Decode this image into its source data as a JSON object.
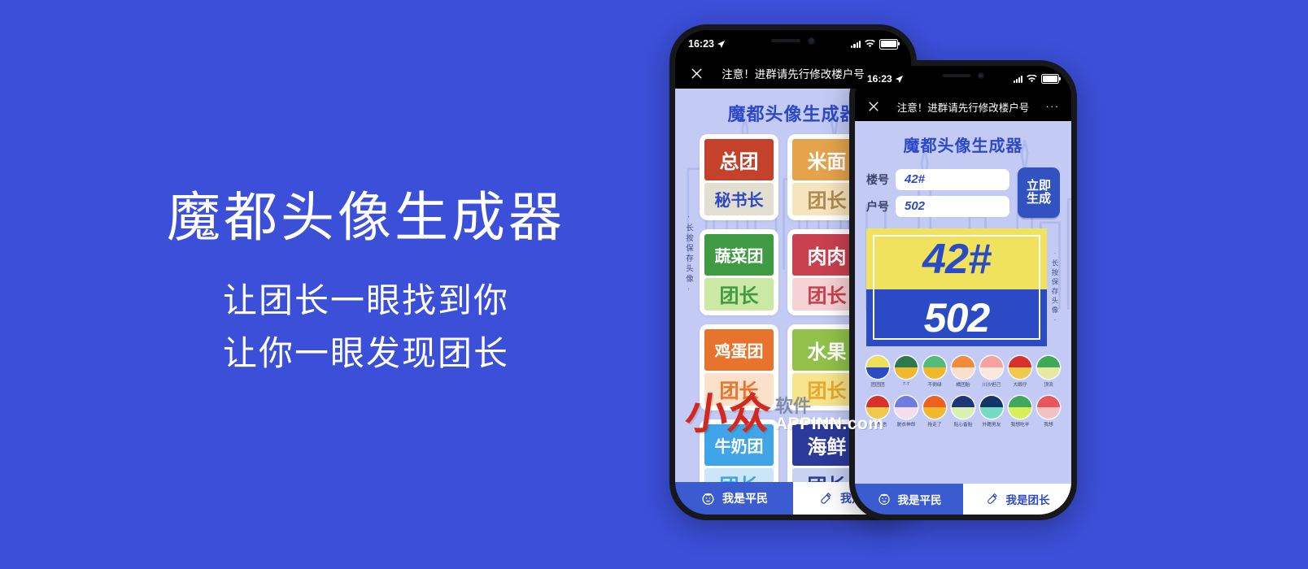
{
  "background_color": "#3B4FD8",
  "promo": {
    "title": "魔都头像生成器",
    "subtitle_line1": "让团长一眼找到你",
    "subtitle_line2": "让你一眼发现团长"
  },
  "watermark": {
    "logo": "小众",
    "cn": "软件",
    "en": "APPINN.com"
  },
  "back_phone": {
    "status": {
      "time": "16:23",
      "location_icon": "location-arrow-icon",
      "signal_icon": "cellular-bars-icon",
      "wifi_icon": "wifi-icon",
      "battery_icon": "battery-icon"
    },
    "nav": {
      "close_icon": "close-icon",
      "title": "注意！进群请先行修改楼户号",
      "more_icon": "more-dots-icon"
    },
    "app_title": "魔都头像生成器",
    "save_tip": "·长按保存头像·",
    "cards": [
      {
        "top": "总团",
        "bottom": "秘书长",
        "top_color": "#C4422C",
        "bottom_bg": "#E2DED0",
        "bottom_color": "#2E49C8"
      },
      {
        "top": "米面",
        "bottom": "团长",
        "top_color": "#E5A34C",
        "bottom_bg": "#F6E4BE",
        "bottom_color": "#B08A4E"
      },
      {
        "top": "蔬菜团",
        "bottom": "团长",
        "top_color": "#3E9B43",
        "bottom_bg": "#CBE8A4",
        "bottom_color": "#3E9B43"
      },
      {
        "top": "肉肉",
        "bottom": "团长",
        "top_color": "#C9404F",
        "bottom_bg": "#F6D2D4",
        "bottom_color": "#C9404F"
      },
      {
        "top": "鸡蛋团",
        "bottom": "团长",
        "top_color": "#E8732C",
        "bottom_bg": "#FBE0CA",
        "bottom_color": "#E8732C"
      },
      {
        "top": "水果",
        "bottom": "团长",
        "top_color": "#91C14A",
        "bottom_bg": "#F6E58C",
        "bottom_color": "#E8A72C"
      },
      {
        "top": "牛奶团",
        "bottom": "团长",
        "top_color": "#3FA4E8",
        "bottom_bg": "#CBE6F8",
        "bottom_color": "#3FA4E8"
      },
      {
        "top": "海鲜",
        "bottom": "团长",
        "top_color": "#2B3A9B",
        "bottom_bg": "#C7D2F0",
        "bottom_color": "#2B3A9B"
      }
    ],
    "tabs": [
      {
        "label": "我是平民",
        "icon": "baby-face-icon",
        "active": true
      },
      {
        "label": "我是团长",
        "icon": "baby-bottle-icon",
        "active": false
      }
    ]
  },
  "front_phone": {
    "status": {
      "time": "16:23",
      "location_icon": "location-arrow-icon",
      "signal_icon": "cellular-bars-icon",
      "wifi_icon": "wifi-icon",
      "battery_icon": "battery-icon"
    },
    "nav": {
      "close_icon": "close-icon",
      "title": "注意！进群请先行修改楼户号",
      "more_icon": "more-dots-icon"
    },
    "app_title": "魔都头像生成器",
    "form": {
      "building_label": "楼号",
      "building_value": "42#",
      "unit_label": "户号",
      "unit_value": "502",
      "generate_label_line1": "立即",
      "generate_label_line2": "生成"
    },
    "preview": {
      "top_text": "42#",
      "bottom_text": "502",
      "top_bg": "#F0E25C",
      "bottom_bg": "#2B4BC6",
      "top_fg": "#2B4BC6",
      "bottom_fg": "#FFFFFF"
    },
    "save_tip": "·长按保存头像·",
    "swatch_rows": [
      [
        {
          "label": "团团团",
          "top": "#EDE05A",
          "bottom": "#2B4BC6"
        },
        {
          "label": "7-7",
          "top": "#2C7A4B",
          "bottom": "#F0B92C"
        },
        {
          "label": "不倒绿",
          "top": "#54BC7B",
          "bottom": "#F0B92C"
        },
        {
          "label": "橘团胎",
          "top": "#F08A3C",
          "bottom": "#FAE0CC"
        },
        {
          "label": "川沙妲己",
          "top": "#F4A3A0",
          "bottom": "#FBE7DC"
        },
        {
          "label": "大眼仔",
          "top": "#D8302A",
          "bottom": "#F0C84C"
        },
        {
          "label": "顶流",
          "top": "#3FA85B",
          "bottom": "#E8E8A0"
        }
      ],
      [
        {
          "label": "上帝预言",
          "top": "#D8302A",
          "bottom": "#F0C84C"
        },
        {
          "label": "脱衣神郎",
          "top": "#6E7BE0",
          "bottom": "#F6DDEE"
        },
        {
          "label": "拖走了",
          "top": "#F0601E",
          "bottom": "#F0B92C"
        },
        {
          "label": "贴心备胎",
          "top": "#1E3578",
          "bottom": "#D8F0B0"
        },
        {
          "label": "外籍男友",
          "top": "#123468",
          "bottom": "#73DCC0"
        },
        {
          "label": "我想吃羊",
          "top": "#3FA85B",
          "bottom": "#D8F055"
        },
        {
          "label": "我想",
          "top": "#E8585A",
          "bottom": "#F2C2C2"
        }
      ]
    ],
    "tabs": [
      {
        "label": "我是平民",
        "icon": "baby-face-icon",
        "active": true
      },
      {
        "label": "我是团长",
        "icon": "baby-bottle-icon",
        "active": false
      }
    ]
  }
}
